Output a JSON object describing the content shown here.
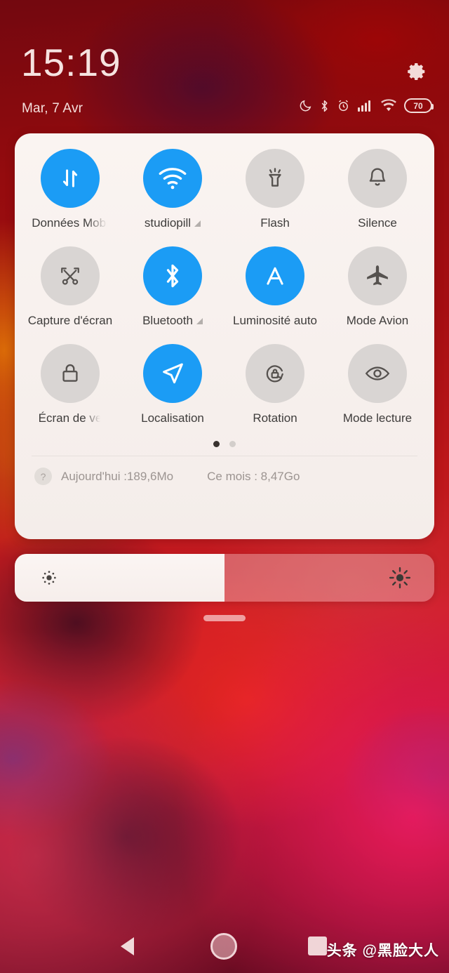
{
  "status_bar": {
    "clock": "15:19",
    "date": "Mar, 7 Avr",
    "battery_level": "70",
    "icons": [
      "do-not-disturb-moon-icon",
      "bluetooth-icon",
      "alarm-clock-icon",
      "signal-bars-icon",
      "wifi-icon",
      "battery-icon"
    ],
    "settings_icon": "gear-icon"
  },
  "quick_settings": {
    "tiles": [
      {
        "label": "Données Mobi",
        "icon": "mobile-data-icon",
        "state": "on",
        "truncated": true,
        "expand": false
      },
      {
        "label": "studiopill",
        "icon": "wifi-icon",
        "state": "on",
        "truncated": false,
        "expand": true
      },
      {
        "label": "Flash",
        "icon": "flashlight-icon",
        "state": "off",
        "truncated": false,
        "expand": false
      },
      {
        "label": "Silence",
        "icon": "bell-icon",
        "state": "off",
        "truncated": false,
        "expand": false
      },
      {
        "label": "Capture d'écran",
        "icon": "screenshot-scissors-icon",
        "state": "off",
        "truncated": false,
        "expand": false
      },
      {
        "label": "Bluetooth",
        "icon": "bluetooth-icon",
        "state": "on",
        "truncated": false,
        "expand": true
      },
      {
        "label": "Luminosité auto",
        "icon": "auto-brightness-a-icon",
        "state": "on",
        "truncated": false,
        "expand": false
      },
      {
        "label": "Mode Avion",
        "icon": "airplane-icon",
        "state": "off",
        "truncated": false,
        "expand": false
      },
      {
        "label": "Écran de ve",
        "icon": "lock-icon",
        "state": "off",
        "truncated": true,
        "expand": false
      },
      {
        "label": "Localisation",
        "icon": "location-arrow-icon",
        "state": "on",
        "truncated": false,
        "expand": false
      },
      {
        "label": "Rotation",
        "icon": "rotation-lock-icon",
        "state": "off",
        "truncated": false,
        "expand": false
      },
      {
        "label": "Mode lecture",
        "icon": "eye-icon",
        "state": "off",
        "truncated": false,
        "expand": false
      }
    ],
    "pages": {
      "count": 2,
      "active_index": 0
    },
    "data_usage": {
      "help_icon": "question-mark-icon",
      "today": "Aujourd'hui :189,6Mo",
      "month": "Ce mois : 8,47Go"
    },
    "colors": {
      "tile_on": "#1b9cf5",
      "tile_off": "#d9d5d3",
      "panel_bg": "#f7f0ed"
    }
  },
  "brightness": {
    "value_percent": 50,
    "low_icon": "brightness-low-sun-icon",
    "high_icon": "brightness-high-sun-icon"
  },
  "nav_bar": {
    "back": "back-triangle-icon",
    "home": "home-circle-icon",
    "recents": "recents-square-icon",
    "watermark": "头条 @黑脸大人"
  }
}
